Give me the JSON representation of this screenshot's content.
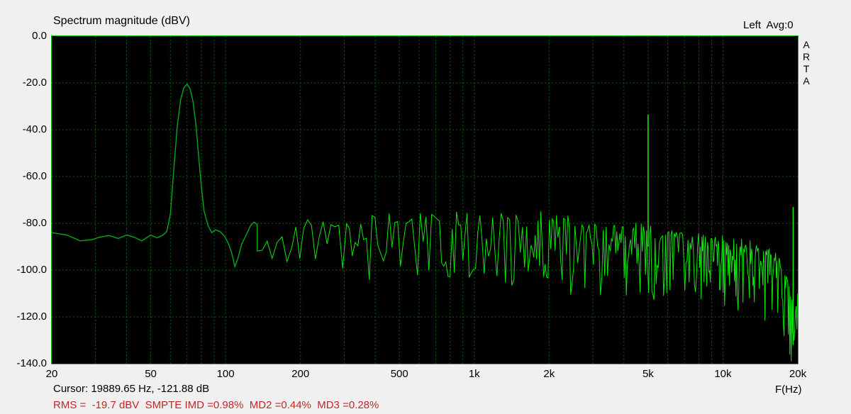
{
  "header": {
    "title": "Spectrum magnitude (dBV)",
    "channel_info": "Left  Avg:0"
  },
  "watermark": {
    "letters": [
      "A",
      "R",
      "T",
      "A"
    ]
  },
  "status": {
    "cursor_text": "Cursor: 19889.65 Hz, -121.88 dB",
    "measurement_text": "RMS =  -19.7 dBV  SMPTE IMD =0.98%  MD2 =0.44%  MD3 =0.28%",
    "measurement_color": "#C02828"
  },
  "chart_data": {
    "type": "line",
    "title": "Spectrum magnitude (dBV)",
    "xlabel": "F(Hz)",
    "ylabel": "dBV",
    "channel": "Left",
    "averages": 0,
    "x_scale": "log",
    "xlim": [
      20,
      20000
    ],
    "ylim": [
      -140,
      0
    ],
    "grid": true,
    "x_ticks": [
      {
        "value": 20,
        "label": "20"
      },
      {
        "value": 50,
        "label": "50"
      },
      {
        "value": 100,
        "label": "100"
      },
      {
        "value": 200,
        "label": "200"
      },
      {
        "value": 500,
        "label": "500"
      },
      {
        "value": 1000,
        "label": "1k"
      },
      {
        "value": 2000,
        "label": "2k"
      },
      {
        "value": 5000,
        "label": "5k"
      },
      {
        "value": 10000,
        "label": "10k"
      },
      {
        "value": 20000,
        "label": "20k"
      }
    ],
    "y_ticks": [
      {
        "value": 0,
        "label": "0.0"
      },
      {
        "value": -20,
        "label": "-20.0"
      },
      {
        "value": -40,
        "label": "-40.0"
      },
      {
        "value": -60,
        "label": "-60.0"
      },
      {
        "value": -80,
        "label": "-80.0"
      },
      {
        "value": -100,
        "label": "-100.0"
      },
      {
        "value": -120,
        "label": "-120.0"
      },
      {
        "value": -140,
        "label": "-140.0"
      }
    ],
    "x_gridlines": [
      30,
      40,
      50,
      60,
      70,
      80,
      90,
      100,
      200,
      300,
      400,
      500,
      600,
      700,
      800,
      900,
      1000,
      2000,
      3000,
      4000,
      5000,
      6000,
      7000,
      8000,
      9000,
      10000
    ],
    "y_gridlines": [
      -20,
      -40,
      -60,
      -80,
      -100,
      -120
    ],
    "colors": {
      "plot_bg": "#000000",
      "border": "#00C800",
      "grid": "#006400",
      "trace": "#00A81E",
      "noise": "#0CE60C"
    },
    "main_tone": {
      "freq_hz": 70,
      "level_db": -20.5
    },
    "spikes": [
      {
        "freq_hz": 5000,
        "level_db": -33.5,
        "base_db": -90
      },
      {
        "freq_hz": 19150,
        "level_db": -73,
        "base_db": -132
      }
    ],
    "trace_points": [
      [
        20,
        -84
      ],
      [
        23,
        -85
      ],
      [
        26,
        -87.5
      ],
      [
        29,
        -87
      ],
      [
        31,
        -86
      ],
      [
        34,
        -85.2
      ],
      [
        37,
        -86.5
      ],
      [
        40,
        -85
      ],
      [
        43,
        -86
      ],
      [
        46,
        -87.5
      ],
      [
        50,
        -85
      ],
      [
        53,
        -86.2
      ],
      [
        56,
        -85
      ],
      [
        58,
        -83.5
      ],
      [
        60,
        -76
      ],
      [
        62,
        -56
      ],
      [
        64,
        -38
      ],
      [
        66,
        -27
      ],
      [
        68,
        -22
      ],
      [
        70,
        -20.5
      ],
      [
        72,
        -22.5
      ],
      [
        74,
        -28
      ],
      [
        76,
        -38
      ],
      [
        78,
        -52
      ],
      [
        80,
        -65
      ],
      [
        82,
        -75
      ],
      [
        85,
        -81
      ],
      [
        88,
        -84
      ],
      [
        91,
        -82.8
      ],
      [
        95,
        -83.5
      ],
      [
        99,
        -85.5
      ],
      [
        103,
        -89
      ],
      [
        106,
        -93
      ],
      [
        109,
        -98.5
      ],
      [
        112,
        -95
      ],
      [
        116,
        -89
      ],
      [
        121,
        -85
      ],
      [
        126,
        -81
      ],
      [
        130,
        -79.5
      ],
      [
        134,
        -80.5
      ]
    ],
    "noise_envelope": [
      [
        134,
        -79.5,
        -96
      ],
      [
        160,
        -80,
        -98
      ],
      [
        200,
        -79,
        -99
      ],
      [
        260,
        -79,
        -100
      ],
      [
        330,
        -80,
        -102
      ],
      [
        430,
        -77,
        -108
      ],
      [
        560,
        -77,
        -105
      ],
      [
        700,
        -76.5,
        -106
      ],
      [
        900,
        -76.5,
        -105
      ],
      [
        1100,
        -77,
        -108
      ],
      [
        1400,
        -76,
        -110
      ],
      [
        1800,
        -76.5,
        -109
      ],
      [
        2300,
        -77.5,
        -111
      ],
      [
        3000,
        -79,
        -112
      ],
      [
        4000,
        -80.5,
        -112
      ],
      [
        5000,
        -81.5,
        -113
      ],
      [
        6500,
        -83.5,
        -114
      ],
      [
        8000,
        -85,
        -115
      ],
      [
        10000,
        -86.5,
        -116
      ],
      [
        12000,
        -88,
        -118
      ],
      [
        14000,
        -89.5,
        -121
      ],
      [
        15500,
        -91.5,
        -125
      ],
      [
        16800,
        -95,
        -130
      ],
      [
        17800,
        -102,
        -136
      ],
      [
        18800,
        -110,
        -140
      ],
      [
        19400,
        -114,
        -140
      ],
      [
        19800,
        -108,
        -140
      ],
      [
        20000,
        -104,
        -140
      ]
    ],
    "readouts": {
      "rms_dbv": -19.7,
      "smpte_imd_pct": 0.98,
      "md2_pct": 0.44,
      "md3_pct": 0.28,
      "cursor_hz": 19889.65,
      "cursor_db": -121.88
    }
  }
}
